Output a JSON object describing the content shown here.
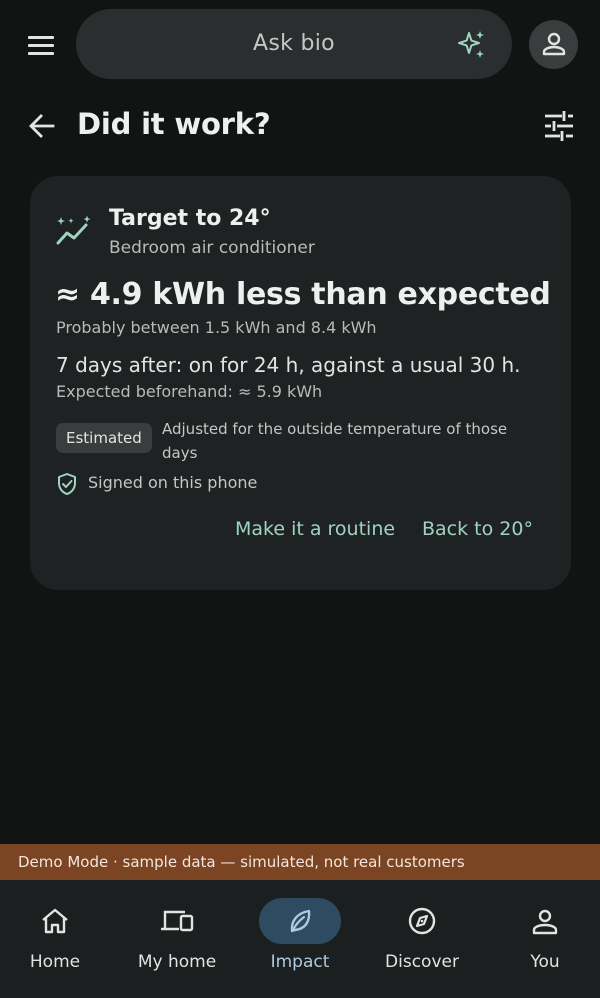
{
  "top_bar": {
    "search_placeholder": "Ask bio"
  },
  "header": {
    "title": "Did it work?"
  },
  "card": {
    "title": "Target to 24°",
    "subtitle": "Bedroom air conditioner",
    "headline": "≈ 4.9 kWh less than expected",
    "range": "Probably between 1.5 kWh and 8.4 kWh",
    "days_after": "7 days after: on for 24 h, against a usual 30 h.",
    "expected": "Expected beforehand: ≈ 5.9 kWh",
    "badge": "Estimated",
    "adjusted_note": "Adjusted for the outside temperature of those days",
    "signed_note": "Signed on this phone",
    "actions": {
      "routine": "Make it a routine",
      "revert": "Back to 20°"
    }
  },
  "demo_banner": "Demo Mode · sample data — simulated, not real customers",
  "bottom_nav": [
    {
      "label": "Home",
      "icon": "home-icon"
    },
    {
      "label": "My home",
      "icon": "devices-icon"
    },
    {
      "label": "Impact",
      "icon": "leaf-icon",
      "active": true
    },
    {
      "label": "Discover",
      "icon": "compass-icon"
    },
    {
      "label": "You",
      "icon": "person-icon"
    }
  ],
  "colors": {
    "background": "#121414",
    "card": "#1f2222",
    "accent_teal": "#9fd3c2",
    "active_nav": "#2f4b61",
    "demo_banner": "#7b4422"
  }
}
